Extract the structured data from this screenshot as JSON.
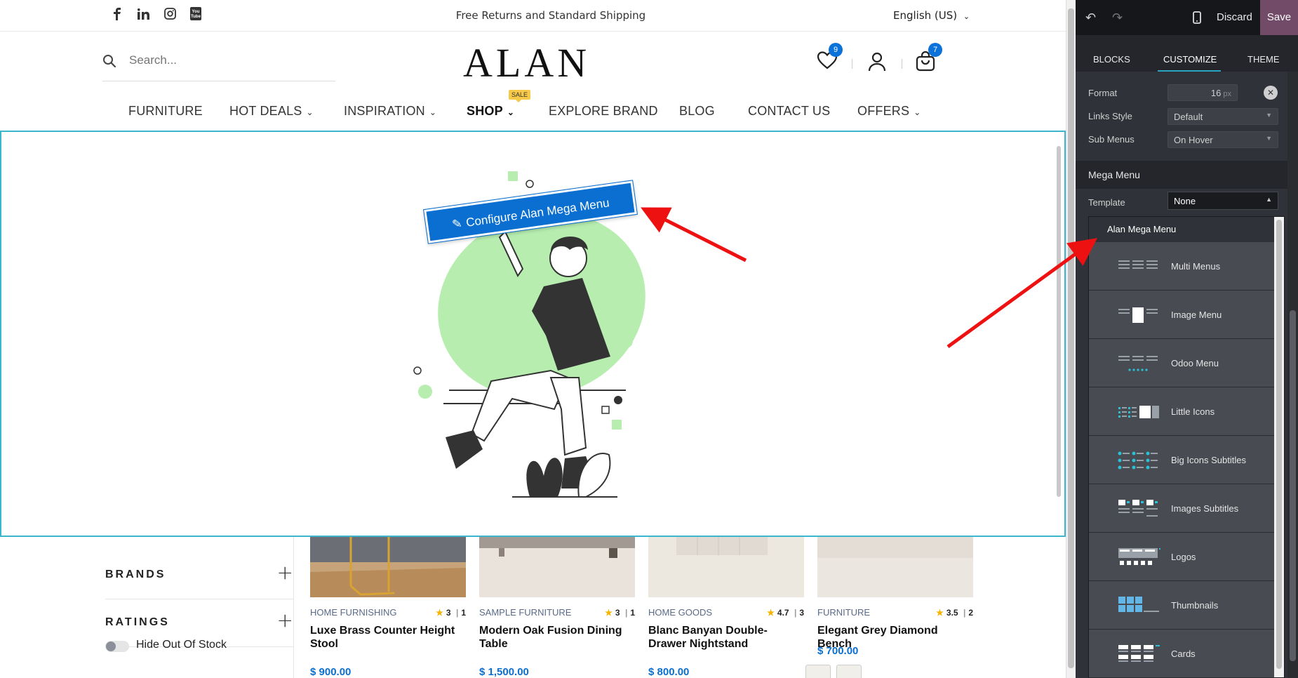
{
  "site": {
    "topbar": {
      "promo": "Free Returns and Standard Shipping",
      "language": "English (US)",
      "social_icons": [
        "facebook-icon",
        "linkedin-icon",
        "instagram-icon",
        "youtube-icon"
      ]
    },
    "search": {
      "placeholder": "Search..."
    },
    "logo": "ALAN",
    "wishlist_count": "9",
    "cart_count": "7",
    "nav": [
      {
        "label": "FURNITURE",
        "has_submenu": false
      },
      {
        "label": "HOT DEALS",
        "has_submenu": true
      },
      {
        "label": "INSPIRATION",
        "has_submenu": true
      },
      {
        "label": "SHOP",
        "has_submenu": true,
        "badge": "SALE",
        "active": true
      },
      {
        "label": "EXPLORE BRAND",
        "has_submenu": false
      },
      {
        "label": "BLOG",
        "has_submenu": false
      },
      {
        "label": "CONTACT US",
        "has_submenu": false
      },
      {
        "label": "OFFERS",
        "has_submenu": true
      }
    ],
    "mega_menu": {
      "configure_label": "Configure Alan Mega Menu"
    },
    "filters": {
      "brands_label": "BRANDS",
      "ratings_label": "RATINGS",
      "hide_out_of_stock_label": "Hide Out Of Stock"
    },
    "products": [
      {
        "category": "HOME FURNISHING",
        "rating": "3",
        "reviews": "1",
        "name": "Luxe Brass Counter Height Stool",
        "price": "$ 900.00"
      },
      {
        "category": "SAMPLE FURNITURE",
        "rating": "3",
        "reviews": "1",
        "name": "Modern Oak Fusion Dining Table",
        "price": "$ 1,500.00"
      },
      {
        "category": "HOME GOODS",
        "rating": "4.7",
        "reviews": "3",
        "name": "Blanc Banyan Double-Drawer Nightstand",
        "price": "$ 800.00"
      },
      {
        "category": "FURNITURE",
        "rating": "3.5",
        "reviews": "2",
        "name": "Elegant Grey Diamond Bench",
        "price": "$ 700.00"
      }
    ]
  },
  "panel": {
    "discard_label": "Discard",
    "save_label": "Save",
    "tabs": [
      "BLOCKS",
      "CUSTOMIZE",
      "THEME"
    ],
    "active_tab": "CUSTOMIZE",
    "format_label": "Format",
    "format_value": "16",
    "format_unit": "px",
    "links_style_label": "Links Style",
    "links_style_value": "Default",
    "sub_menus_label": "Sub Menus",
    "sub_menus_value": "On Hover",
    "mega_menu_section": "Mega Menu",
    "template_label": "Template",
    "template_value": "None",
    "dropdown_header": "Alan Mega Menu",
    "template_options": [
      "Multi Menus",
      "Image Menu",
      "Odoo Menu",
      "Little Icons",
      "Big Icons Subtitles",
      "Images Subtitles",
      "Logos",
      "Thumbnails",
      "Cards"
    ]
  },
  "colors": {
    "accent_blue": "#0a6fd0",
    "badge_blue": "#0a72d8",
    "save_purple": "#714b67",
    "highlight_cyan": "#3bb6cc",
    "annotation_red": "#ee1111",
    "illustration_green": "#b7eeb0"
  }
}
